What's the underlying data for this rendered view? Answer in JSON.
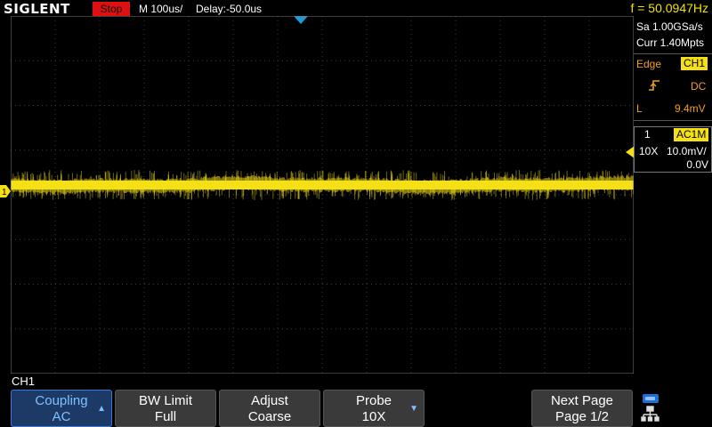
{
  "topbar": {
    "logo": "SIGLENT",
    "run_state": "Stop",
    "timebase": "M 100us/",
    "delay": "Delay:-50.0us",
    "frequency": "f = 50.0947Hz"
  },
  "acquire": {
    "sample_rate": "Sa 1.00GSa/s",
    "memory": "Curr 1.40Mpts"
  },
  "trigger": {
    "type_label": "Edge",
    "source": "CH1",
    "coupling": "DC",
    "level_label": "L",
    "level": "9.4mV"
  },
  "channel": {
    "number": "1",
    "coupling_impedance": "AC1M",
    "probe": "10X",
    "scale": "10.0mV/",
    "offset": "0.0V",
    "menu_title": "CH1",
    "marker_label": "1"
  },
  "softkeys": [
    {
      "title": "Coupling",
      "value": "AC"
    },
    {
      "title": "BW Limit",
      "value": "Full"
    },
    {
      "title": "Adjust",
      "value": "Coarse"
    },
    {
      "title": "Probe",
      "value": "10X"
    },
    {
      "title": "Next Page",
      "value": "Page 1/2"
    }
  ],
  "colors": {
    "ch1": "#f5e016",
    "trigger_marker": "#1e9bd7",
    "run_state_bg": "#d11111",
    "menu_accent": "#3d7ad8"
  },
  "icons": {
    "edge": "rising-edge-icon",
    "usb": "usb-icon",
    "network": "network-icon"
  }
}
